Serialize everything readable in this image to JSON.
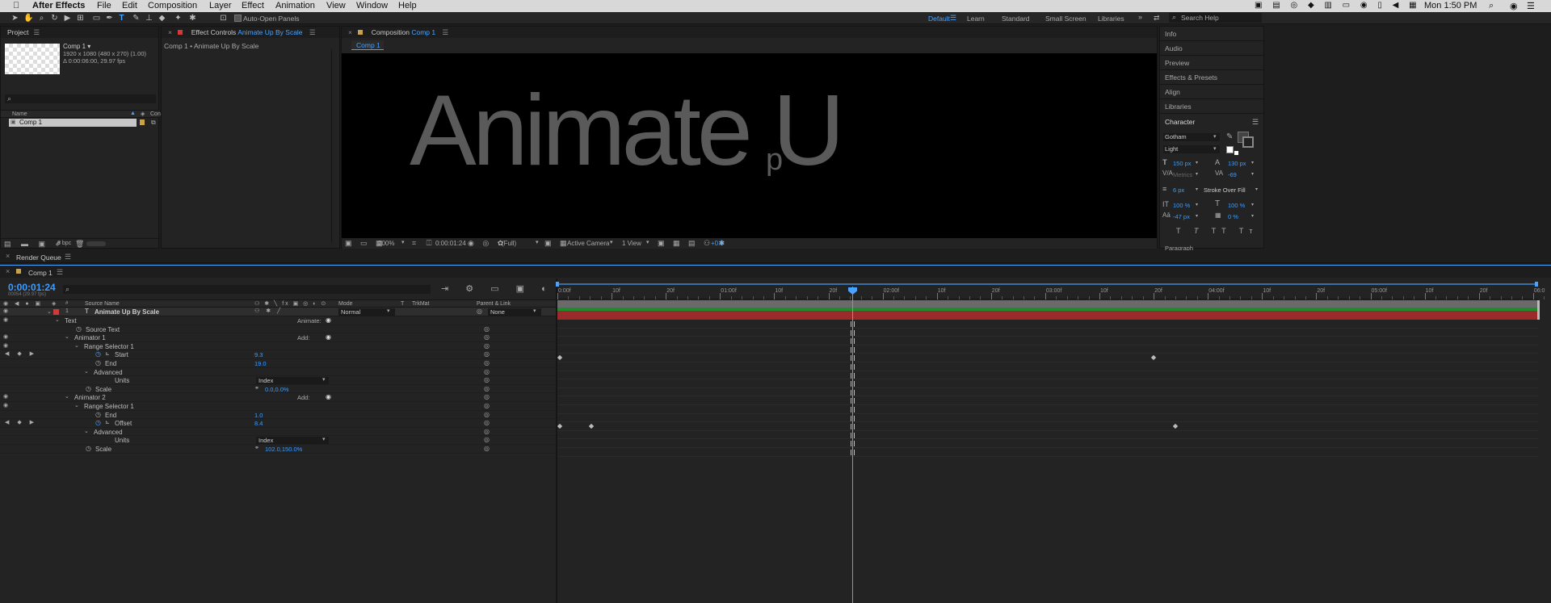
{
  "menubar": {
    "app": "After Effects",
    "items": [
      "File",
      "Edit",
      "Composition",
      "Layer",
      "Effect",
      "Animation",
      "View",
      "Window",
      "Help"
    ],
    "clock": "Mon 1:50 PM"
  },
  "toolbar": {
    "auto_open_label": "Auto-Open Panels",
    "workspaces": [
      "Default",
      "Learn",
      "Standard",
      "Small Screen",
      "Libraries"
    ],
    "search_placeholder": "Search Help"
  },
  "project": {
    "title": "Project",
    "comp_name": "Comp 1 ▾",
    "comp_dims": "1920 x 1080  (480 x 270) (1.00)",
    "comp_duration": "Δ 0:00:06:00, 29.97 fps",
    "search_placeholder": "",
    "col_name": "Name",
    "col_com": "Con",
    "item": "Comp 1",
    "bpc": "8 bpc"
  },
  "effect_controls": {
    "title_prefix": "Effect Controls",
    "title_layer": "Animate Up By Scale",
    "subtitle": "Comp 1 • Animate Up By Scale"
  },
  "composition": {
    "title_prefix": "Composition",
    "title_comp": "Comp 1",
    "tab": "Comp 1",
    "canvas_text": "Animate U",
    "canvas_text_small": "p",
    "zoom": "200%",
    "timecode": "0:00:01:24",
    "resolution": "(Full)",
    "camera": "Active Camera",
    "views": "1 View",
    "exposure": "+0.0"
  },
  "right_panels": [
    "Info",
    "Audio",
    "Preview",
    "Effects & Presets",
    "Align",
    "Libraries"
  ],
  "character": {
    "title": "Character",
    "font": "Gotham",
    "style": "Light",
    "size": "150 px",
    "leading": "130 px",
    "kerning": "Metrics",
    "tracking": "-69",
    "stroke_width": "6 px",
    "stroke_mode": "Stroke Over Fill",
    "vscale": "100 %",
    "hscale": "100 %",
    "baseline": "-47 px",
    "tsume": "0 %",
    "paragraph": "Paragraph"
  },
  "render_queue": {
    "title": "Render Queue"
  },
  "timeline": {
    "tab": "Comp 1",
    "timecode": "0:00:01:24",
    "frames": "00054 (29.97 fps)",
    "cols": {
      "source_name": "Source Name",
      "mode": "Mode",
      "t": "T",
      "trkmat": "TrkMat",
      "parent": "Parent & Link"
    },
    "ruler": [
      "0:00f",
      "10f",
      "20f",
      "01:00f",
      "10f",
      "20f",
      "02:00f",
      "10f",
      "20f",
      "03:00f",
      "10f",
      "20f",
      "04:00f",
      "10f",
      "20f",
      "05:00f",
      "10f",
      "20f",
      "06:0"
    ],
    "layer": {
      "num": "1",
      "name": "Animate Up By Scale",
      "mode": "Normal",
      "parent": "None"
    },
    "rows": [
      {
        "label": "Text",
        "indent": 0,
        "right": "Animate:",
        "type": "group"
      },
      {
        "label": "Source Text",
        "indent": 2,
        "type": "prop"
      },
      {
        "label": "Animator 1",
        "indent": 1,
        "right": "Add:",
        "type": "group"
      },
      {
        "label": "Range Selector 1",
        "indent": 2,
        "type": "group"
      },
      {
        "label": "Start",
        "indent": 4,
        "value": "9.3",
        "type": "key"
      },
      {
        "label": "End",
        "indent": 4,
        "value": "19.0",
        "type": "prop"
      },
      {
        "label": "Advanced",
        "indent": 3,
        "type": "group"
      },
      {
        "label": "Units",
        "indent": 5,
        "value": "Index",
        "type": "dropdown"
      },
      {
        "label": "Scale",
        "indent": 3,
        "value": "0.0,0.0%",
        "type": "link"
      },
      {
        "label": "Animator 2",
        "indent": 1,
        "right": "Add:",
        "type": "group"
      },
      {
        "label": "Range Selector 1",
        "indent": 2,
        "type": "group"
      },
      {
        "label": "End",
        "indent": 4,
        "value": "1.0",
        "type": "prop"
      },
      {
        "label": "Offset",
        "indent": 4,
        "value": "8.4",
        "type": "key"
      },
      {
        "label": "Advanced",
        "indent": 3,
        "type": "group"
      },
      {
        "label": "Units",
        "indent": 5,
        "value": "Index",
        "type": "dropdown"
      },
      {
        "label": "Scale",
        "indent": 3,
        "value": "102.0,150.0%",
        "type": "link"
      }
    ]
  }
}
